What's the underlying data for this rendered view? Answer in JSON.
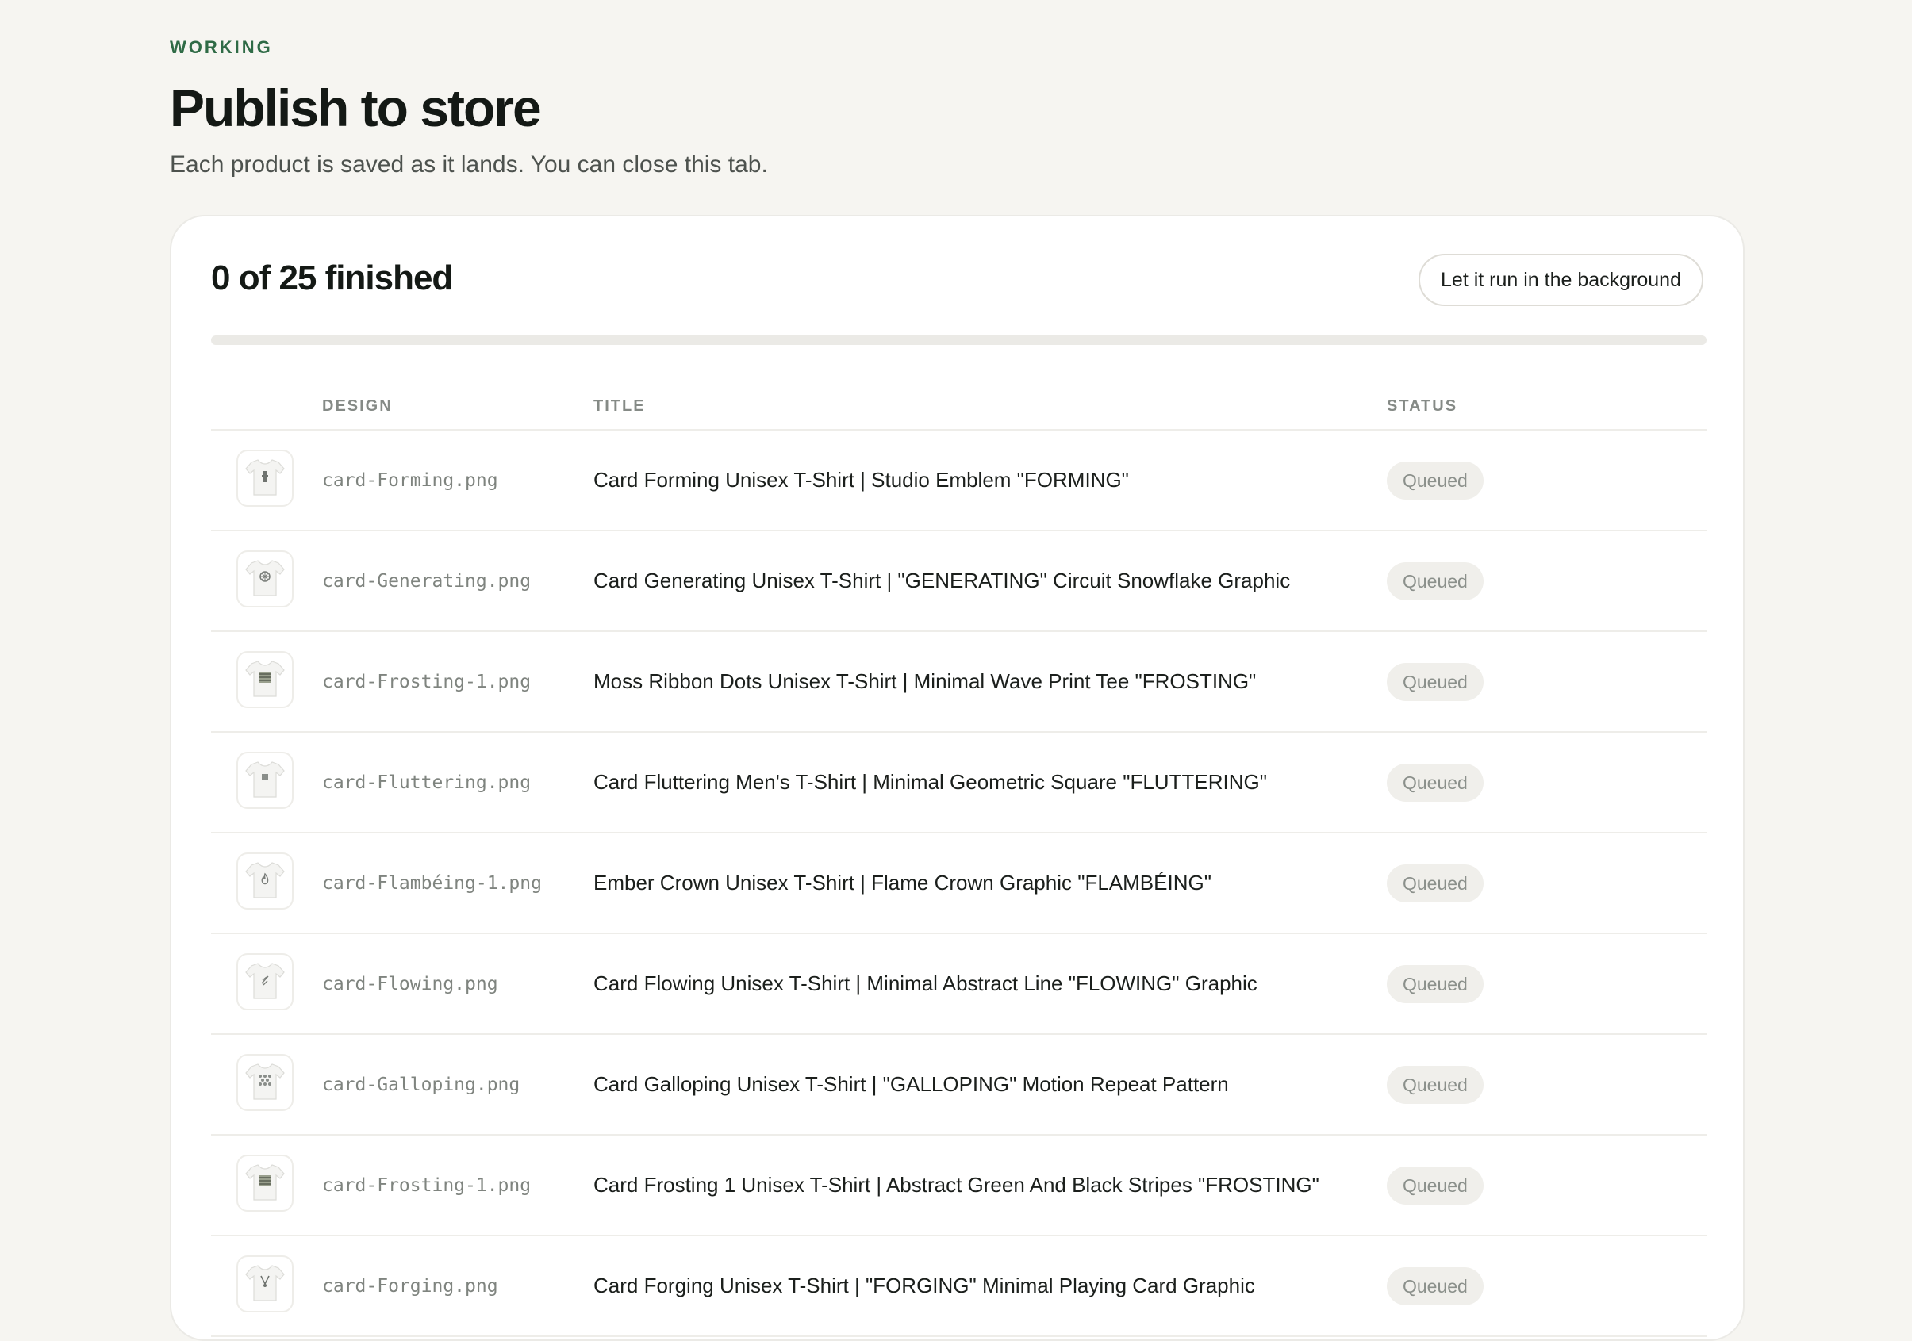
{
  "header": {
    "eyebrow": "WORKING",
    "title": "Publish to store",
    "subtitle": "Each product is saved as it lands. You can close this tab."
  },
  "progress": {
    "summary": "0 of 25 finished",
    "finished": 0,
    "total": 25,
    "background_button": "Let it run in the background"
  },
  "table": {
    "columns": {
      "design": "DESIGN",
      "title": "TITLE",
      "status": "STATUS"
    },
    "rows": [
      {
        "file": "card-Forming.png",
        "title": "Card Forming Unisex T-Shirt | Studio Emblem \"FORMING\"",
        "status": "Queued",
        "icon": "tshirt-emblem-icon"
      },
      {
        "file": "card-Generating.png",
        "title": "Card Generating Unisex T-Shirt | \"GENERATING\" Circuit Snowflake Graphic",
        "status": "Queued",
        "icon": "tshirt-snowflake-icon"
      },
      {
        "file": "card-Frosting-1.png",
        "title": "Moss Ribbon Dots Unisex T-Shirt | Minimal Wave Print Tee \"FROSTING\"",
        "status": "Queued",
        "icon": "tshirt-stripes-icon"
      },
      {
        "file": "card-Fluttering.png",
        "title": "Card Fluttering Men's T-Shirt | Minimal Geometric Square \"FLUTTERING\"",
        "status": "Queued",
        "icon": "tshirt-square-icon"
      },
      {
        "file": "card-Flambéing-1.png",
        "title": "Ember Crown Unisex T-Shirt | Flame Crown Graphic \"FLAMBÉING\"",
        "status": "Queued",
        "icon": "tshirt-flame-icon"
      },
      {
        "file": "card-Flowing.png",
        "title": "Card Flowing Unisex T-Shirt | Minimal Abstract Line \"FLOWING\" Graphic",
        "status": "Queued",
        "icon": "tshirt-line-icon"
      },
      {
        "file": "card-Galloping.png",
        "title": "Card Galloping Unisex T-Shirt | \"GALLOPING\" Motion Repeat Pattern",
        "status": "Queued",
        "icon": "tshirt-pattern-icon"
      },
      {
        "file": "card-Frosting-1.png",
        "title": "Card Frosting 1 Unisex T-Shirt | Abstract Green And Black Stripes \"FROSTING\"",
        "status": "Queued",
        "icon": "tshirt-stripes-icon"
      },
      {
        "file": "card-Forging.png",
        "title": "Card Forging Unisex T-Shirt | \"FORGING\" Minimal Playing Card Graphic",
        "status": "Queued",
        "icon": "tshirt-card-icon"
      }
    ]
  }
}
